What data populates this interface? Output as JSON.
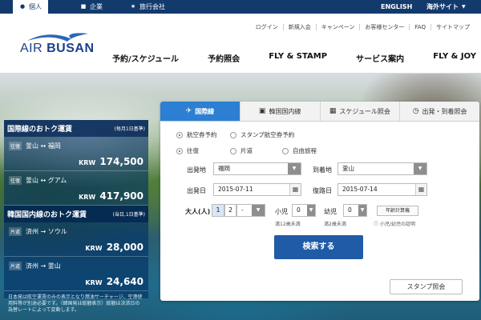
{
  "topbar": {
    "tabs": [
      {
        "label": "個人",
        "icon": "person-icon"
      },
      {
        "label": "企業",
        "icon": "briefcase-icon"
      },
      {
        "label": "旅行会社",
        "icon": "star-icon"
      }
    ],
    "lang": "ENGLISH",
    "overseas": "海外サイト"
  },
  "logo": {
    "a": "AIR",
    "b": "BUSAN"
  },
  "util_links": [
    "ログイン",
    "新規入会",
    "キャンペーン",
    "お客様センター",
    "FAQ",
    "サイトマップ"
  ],
  "nav": [
    "予約/スケジュール",
    "予約照会",
    "FLY & STAMP",
    "サービス案内",
    "FLY & JOY"
  ],
  "deals": {
    "intl": {
      "title": "国際線のおトク運賃",
      "sub": "(毎月1日基準)"
    },
    "routes1": [
      {
        "tag": "往復",
        "route": "釜山 ↔ 福岡",
        "cur": "KRW",
        "price": "174,500"
      },
      {
        "tag": "往復",
        "route": "釜山 ↔ グアム",
        "cur": "KRW",
        "price": "417,900"
      }
    ],
    "dom": {
      "title": "韓国国内線のおトク運賃",
      "sub": "(当日,1日基準)"
    },
    "routes2": [
      {
        "tag": "片道",
        "route": "済州 → ソウル",
        "cur": "KRW",
        "price": "28,000"
      },
      {
        "tag": "片道",
        "route": "済州 → 釜山",
        "cur": "KRW",
        "price": "24,640"
      }
    ],
    "note": "日本発は航空運賃のみの表示となり燃油サーチャージ、空港使用料等が別途必要です。（韓国発は総額表示）総額は決済日の為替レートによって変動します。"
  },
  "panel": {
    "tabs": [
      {
        "label": "国際線",
        "icon": "plane-icon"
      },
      {
        "label": "韓国国内線",
        "icon": "suitcase-icon"
      },
      {
        "label": "スケジュール照会",
        "icon": "calendar-icon"
      },
      {
        "label": "出発・到着照会",
        "icon": "clock-icon"
      }
    ],
    "ticket_types": [
      "航空券予約",
      "スタンプ航空券予約"
    ],
    "trip_types": [
      "往復",
      "片道",
      "自由旅程"
    ],
    "dep_label": "出発地",
    "dep_value": "福岡",
    "arr_label": "到着地",
    "arr_value": "釜山",
    "depdate_label": "出発日",
    "depdate_value": "2015-07-11",
    "retdate_label": "復路日",
    "retdate_value": "2015-07-14",
    "adult_label": "大人(人)",
    "adult_opts": [
      "1",
      "2",
      "-"
    ],
    "child_label": "小児",
    "child_value": "0",
    "child_note": "満12歳未満",
    "infant_label": "幼児",
    "infant_value": "0",
    "infant_note": "満2歳未満",
    "calc_btn": "年齢計算機",
    "proof": "小児/幼児の証明",
    "search": "検索する",
    "stamp": "スタンプ照会"
  }
}
